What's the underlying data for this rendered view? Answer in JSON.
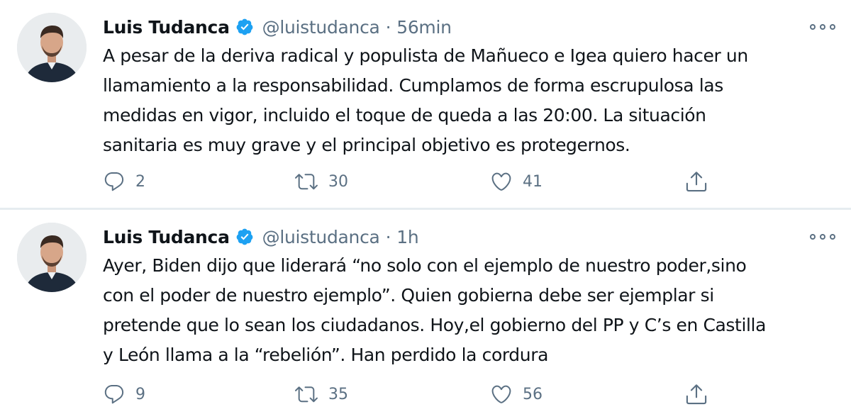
{
  "tweets": [
    {
      "author_name": "Luis Tudanca",
      "handle": "@luistudanca",
      "separator": "·",
      "time": "56min",
      "lines": [
        "A pesar de la deriva radical y populista de Mañueco e Igea quiero hacer un",
        "llamamiento a la responsabilidad. Cumplamos de forma escrupulosa las",
        "medidas en vigor, incluido el toque de queda a las 20:00. La situación",
        "sanitaria es muy grave y el principal objetivo es protegernos."
      ],
      "replies": "2",
      "retweets": "30",
      "likes": "41"
    },
    {
      "author_name": "Luis Tudanca",
      "handle": "@luistudanca",
      "separator": "·",
      "time": "1h",
      "lines": [
        "Ayer, Biden dijo que liderará “no solo con el ejemplo de nuestro poder,sino",
        "con el poder de nuestro ejemplo”. Quien gobierna debe ser ejemplar si",
        "pretende que lo sean los ciudadanos. Hoy,el gobierno del PP y C’s en Castilla",
        "y León llama a la “rebelión”. Han perdido la cordura"
      ],
      "replies": "9",
      "retweets": "35",
      "likes": "56"
    }
  ],
  "icons": {
    "verified": "verified-badge-icon",
    "more": "more-options-icon",
    "reply": "reply-icon",
    "retweet": "retweet-icon",
    "like": "heart-icon",
    "share": "share-icon"
  },
  "colors": {
    "accent": "#1da1f2",
    "secondary_text": "#5b7083",
    "primary_text": "#0f1419",
    "divider": "#e6ecf0"
  }
}
